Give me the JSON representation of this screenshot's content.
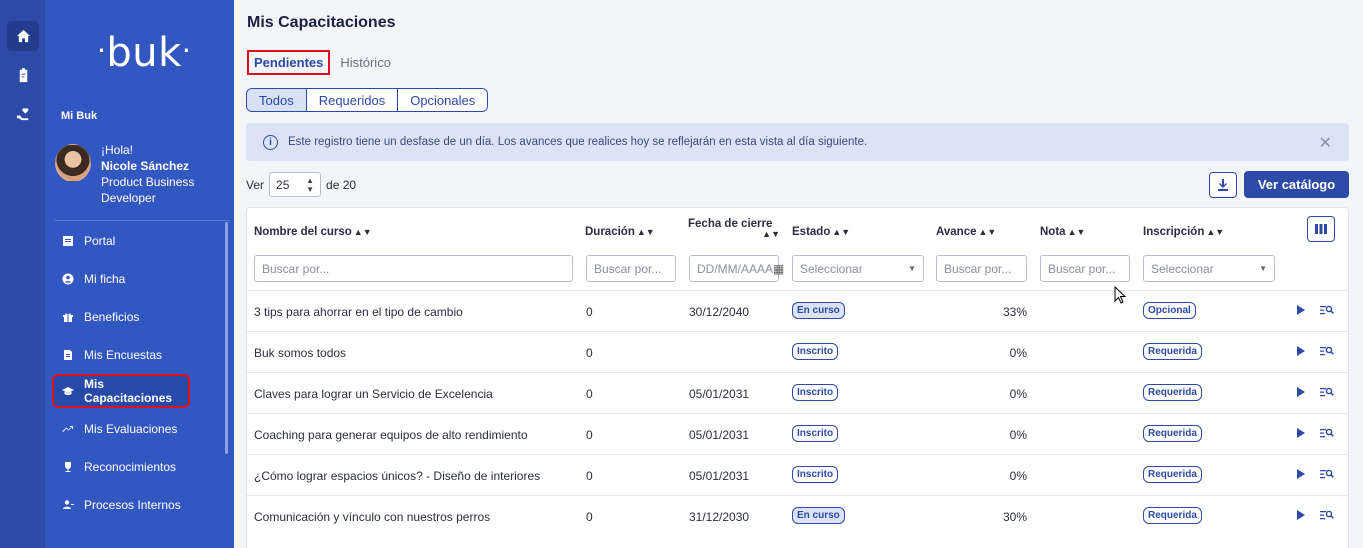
{
  "rail": {
    "items": [
      {
        "icon": "home-icon"
      },
      {
        "icon": "clipboard-icon"
      },
      {
        "icon": "heart-hand-icon"
      }
    ]
  },
  "sidebar": {
    "logo": "buk",
    "section": "Mi Buk",
    "user": {
      "greeting": "¡Hola!",
      "name": "Nicole Sánchez",
      "role": "Product Business Developer"
    },
    "items": [
      {
        "label": "Portal",
        "icon": "document-icon"
      },
      {
        "label": "Mi ficha",
        "icon": "user-circle-icon"
      },
      {
        "label": "Beneficios",
        "icon": "gift-icon"
      },
      {
        "label": "Mis Encuestas",
        "icon": "survey-icon"
      },
      {
        "label": "Mis Capacitaciones",
        "icon": "graduation-cap-icon"
      },
      {
        "label": "Mis Evaluaciones",
        "icon": "trend-icon"
      },
      {
        "label": "Reconocimientos",
        "icon": "trophy-icon"
      },
      {
        "label": "Procesos Internos",
        "icon": "people-icon"
      }
    ]
  },
  "main": {
    "title": "Mis Capacitaciones",
    "tabs": [
      "Pendientes",
      "Histórico"
    ],
    "segments": [
      "Todos",
      "Requeridos",
      "Opcionales"
    ],
    "alert": "Este registro tiene un desfase de un día. Los avances que realices hoy se reflejarán en esta vista al día siguiente.",
    "pager": {
      "prefix": "Ver",
      "value": "25",
      "suffix": "de 20"
    },
    "catalog_button": "Ver catálogo",
    "columns": {
      "name": "Nombre del curso",
      "duration": "Duración",
      "close_date": "Fecha de cierre",
      "status": "Estado",
      "progress": "Avance",
      "grade": "Nota",
      "enrollment": "Inscripción"
    },
    "filters": {
      "name": "Buscar por...",
      "duration": "Buscar por...",
      "date": "DD/MM/AAAA",
      "status": "Seleccionar",
      "progress": "Buscar por...",
      "grade": "Buscar por...",
      "enrollment": "Seleccionar"
    },
    "rows": [
      {
        "name": "3 tips para ahorrar en el tipo de cambio",
        "duration": "0",
        "date": "30/12/2040",
        "status": "En curso",
        "status_filled": true,
        "progress": "33%",
        "grade": "",
        "enrollment": "Opcional"
      },
      {
        "name": "Buk somos todos",
        "duration": "0",
        "date": "",
        "status": "Inscrito",
        "status_filled": false,
        "progress": "0%",
        "grade": "",
        "enrollment": "Requerida"
      },
      {
        "name": "Claves para lograr un Servicio de Excelencia",
        "duration": "0",
        "date": "05/01/2031",
        "status": "Inscrito",
        "status_filled": false,
        "progress": "0%",
        "grade": "",
        "enrollment": "Requerida"
      },
      {
        "name": "Coaching para generar equipos de alto rendimiento",
        "duration": "0",
        "date": "05/01/2031",
        "status": "Inscrito",
        "status_filled": false,
        "progress": "0%",
        "grade": "",
        "enrollment": "Requerida"
      },
      {
        "name": "¿Cómo lograr espacios únicos? - Diseño de interiores",
        "duration": "0",
        "date": "05/01/2031",
        "status": "Inscrito",
        "status_filled": false,
        "progress": "0%",
        "grade": "",
        "enrollment": "Requerida"
      },
      {
        "name": "Comunicación y vínculo con nuestros perros",
        "duration": "0",
        "date": "31/12/2030",
        "status": "En curso",
        "status_filled": true,
        "progress": "30%",
        "grade": "",
        "enrollment": "Requerida"
      }
    ]
  },
  "colors": {
    "primary": "#2c4aa6",
    "sidebar": "#3357c0",
    "highlight": "#e0101a",
    "alert_bg": "#dce3f6"
  }
}
